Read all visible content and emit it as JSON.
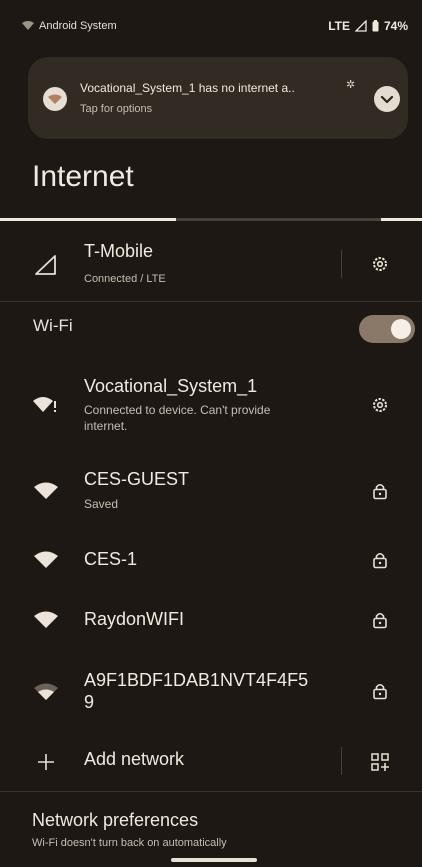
{
  "status_bar": {
    "app": "Android System",
    "network": "LTE",
    "battery": "74%"
  },
  "notification": {
    "title": "Vocational_System_1 has no internet a..",
    "subtitle": "Tap for options"
  },
  "page": {
    "title": "Internet"
  },
  "mobile": {
    "carrier": "T-Mobile",
    "status": "Connected / LTE"
  },
  "wifi": {
    "label": "Wi-Fi",
    "enabled": true,
    "networks": [
      {
        "name": "Vocational_System_1",
        "status_line1": "Connected to device. Can't provide",
        "status_line2": "internet."
      },
      {
        "name": "CES-GUEST",
        "status": "Saved"
      },
      {
        "name": "CES-1"
      },
      {
        "name": "RaydonWIFI"
      },
      {
        "name_line1": "A9F1BDF1DAB1NVT4F4F5",
        "name_line2": "9"
      }
    ]
  },
  "add_network": {
    "label": "Add network"
  },
  "preferences": {
    "title": "Network preferences",
    "subtitle": "Wi-Fi doesn't turn back on automatically"
  },
  "colors": {
    "background": "#1d1813",
    "card": "#322b24",
    "accent": "#efe6dc",
    "toggle_track": "#8a7968"
  }
}
